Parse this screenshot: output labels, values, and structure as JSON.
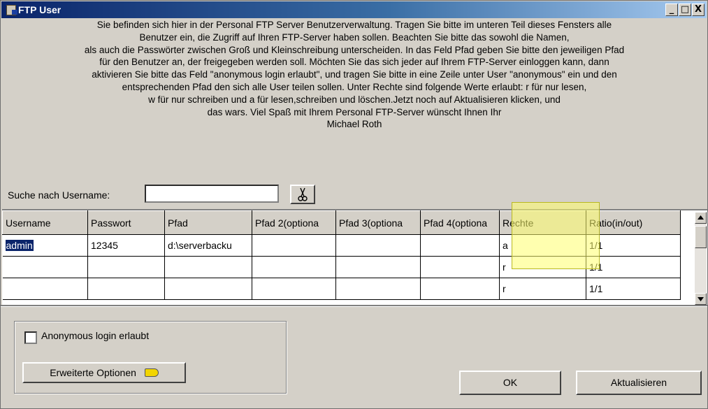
{
  "window": {
    "title": "FTP User",
    "buttons": {
      "minimize": "_",
      "maximize": "□",
      "close": "X"
    }
  },
  "intro_lines": [
    "Sie befinden sich hier in der Personal FTP Server Benutzerverwaltung. Tragen Sie bitte im unteren Teil dieses Fensters alle",
    "Benutzer ein, die Zugriff auf Ihren FTP-Server haben sollen. Beachten Sie bitte das sowohl die Namen,",
    "als auch die Passwörter zwischen Groß und Kleinschreibung unterscheiden. In das Feld Pfad geben Sie bitte den jeweiligen Pfad",
    "für den Benutzer an, der freigegeben werden soll. Möchten Sie das sich jeder auf Ihrem FTP-Server einloggen kann, dann",
    "aktivieren Sie bitte das Feld \"anonymous login erlaubt\", und tragen Sie bitte in eine Zeile unter User \"anonymous\" ein und den",
    "entsprechenden Pfad den sich alle User teilen sollen. Unter Rechte sind folgende Werte erlaubt: r für nur lesen,",
    "w für nur schreiben und a für lesen,schreiben und löschen.Jetzt noch auf Aktualisieren klicken, und",
    "das wars. Viel Spaß mit Ihrem Personal FTP-Server wünscht Ihnen Ihr",
    "Michael Roth"
  ],
  "search": {
    "label": "Suche nach Username:",
    "value": ""
  },
  "grid": {
    "columns": [
      "Username",
      "Passwort",
      "Pfad",
      "Pfad 2(optiona",
      "Pfad 3(optiona",
      "Pfad 4(optiona",
      "Rechte",
      "Ratio(in/out)"
    ],
    "rows": [
      [
        "admin",
        "12345",
        "d:\\serverbacku",
        "",
        "",
        "",
        "a",
        "1/1"
      ],
      [
        "",
        "",
        "",
        "",
        "",
        "",
        "r",
        "1/1"
      ],
      [
        "",
        "",
        "",
        "",
        "",
        "",
        "r",
        "1/1"
      ]
    ]
  },
  "anonymous": {
    "label": "Anonymous login erlaubt",
    "checked": false
  },
  "buttons": {
    "extended": "Erweiterte Optionen",
    "ok": "OK",
    "update": "Aktualisieren"
  }
}
